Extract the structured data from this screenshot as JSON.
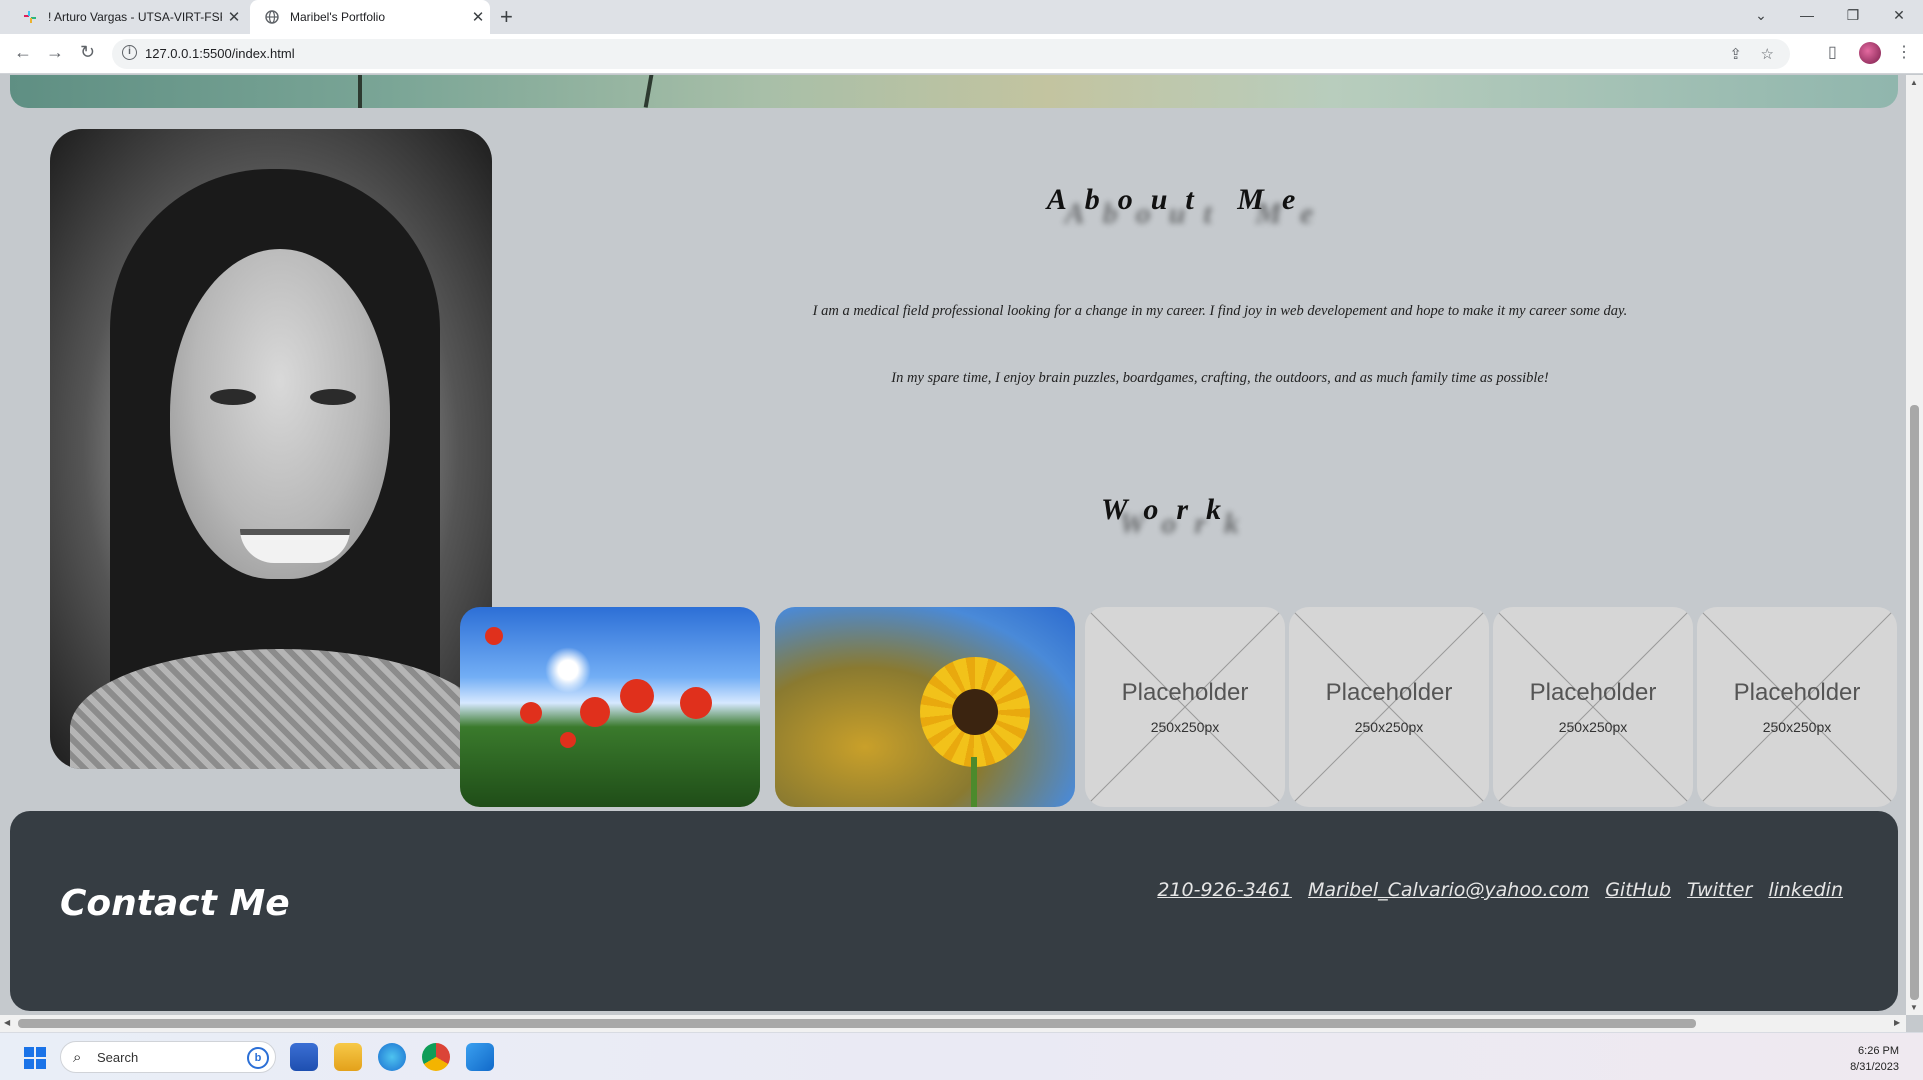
{
  "browser": {
    "tabs": [
      {
        "title": "! Arturo Vargas - UTSA-VIRT-FSF",
        "active": false
      },
      {
        "title": "Maribel's Portfolio",
        "active": true
      }
    ],
    "url": "127.0.0.1:5500/index.html",
    "new_tab": "+",
    "close": "✕"
  },
  "page": {
    "about_title": "About Me",
    "about_p1": "I am a medical field professional looking for a change in my career. I find joy in web developement and hope to make it my career some day.",
    "about_p2": "In my spare time, I enjoy brain puzzles, boardgames, crafting, the outdoors, and as much family time as possible!",
    "work_title": "Work",
    "placeholders": [
      {
        "label": "Placeholder",
        "size": "250x250px"
      },
      {
        "label": "Placeholder",
        "size": "250x250px"
      },
      {
        "label": "Placeholder",
        "size": "250x250px"
      },
      {
        "label": "Placeholder",
        "size": "250x250px"
      }
    ],
    "footer": {
      "heading": "Contact Me",
      "links": [
        "210-926-3461",
        "Maribel_Calvario@yahoo.com",
        "GitHub",
        "Twitter",
        "linkedin"
      ]
    }
  },
  "taskbar": {
    "search_label": "Search",
    "time": "6:26 PM",
    "date": "8/31/2023"
  },
  "colors": {
    "page_bg": "#c5c9cd",
    "footer_bg": "#363d43",
    "placeholder_bg": "#d6d6d6"
  }
}
